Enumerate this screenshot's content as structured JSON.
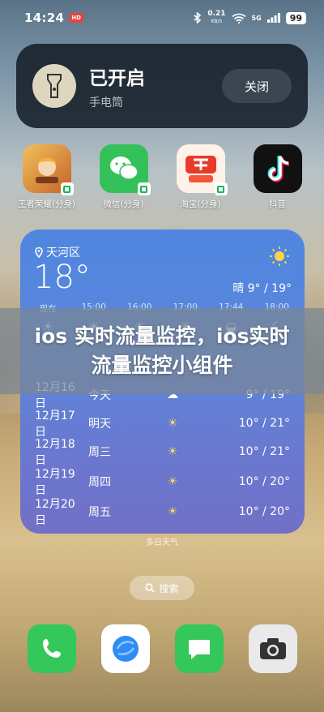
{
  "status_bar": {
    "time": "14:24",
    "hd_badge": "HD",
    "net_speed": "0.21",
    "net_unit": "KB/S",
    "signal": "5G",
    "battery": "99"
  },
  "flashlight": {
    "title": "已开启",
    "subtitle": "手电筒",
    "close_label": "关闭"
  },
  "apps": [
    {
      "label": "王者荣耀(分身)",
      "icon": "game-hero-icon",
      "color": "#e8a43c"
    },
    {
      "label": "微信(分身)",
      "icon": "wechat-icon",
      "color": "#35c15a"
    },
    {
      "label": "淘宝(分身)",
      "icon": "taobao-icon",
      "color": "#e83a2a"
    },
    {
      "label": "抖音",
      "icon": "tiktok-icon",
      "color": "#111111"
    }
  ],
  "weather": {
    "location": "天河区",
    "temp": "18°",
    "condition": "晴 9° / 19°",
    "hours": [
      "现在",
      "15:00",
      "16:00",
      "17:00",
      "17:44",
      "18:00"
    ],
    "days": [
      {
        "date": "12月16日",
        "week": "今天",
        "range": "9° / 19°"
      },
      {
        "date": "12月17日",
        "week": "明天",
        "range": "10° / 21°"
      },
      {
        "date": "12月18日",
        "week": "周三",
        "range": "10° / 21°"
      },
      {
        "date": "12月19日",
        "week": "周四",
        "range": "10° / 20°"
      },
      {
        "date": "12月20日",
        "week": "周五",
        "range": "10° / 20°"
      }
    ],
    "footer": "多日天气"
  },
  "banner": {
    "text": "ios 实时流量监控，ios实时流量监控小组件"
  },
  "search": {
    "label": "搜索"
  },
  "dock": [
    {
      "icon": "phone-icon",
      "color": "#34c759"
    },
    {
      "icon": "browser-icon",
      "color": "#ffffff"
    },
    {
      "icon": "messages-icon",
      "color": "#34c759"
    },
    {
      "icon": "camera-icon",
      "color": "#e9e9eb"
    }
  ]
}
